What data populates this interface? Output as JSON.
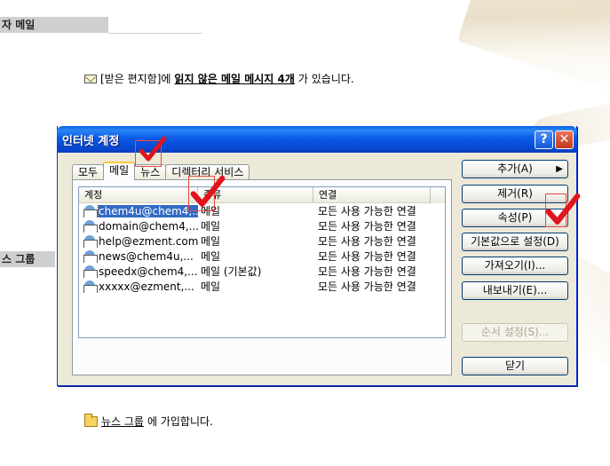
{
  "page": {
    "section1": "자 메일",
    "section2": "스 그룹",
    "msg_prefix": "[받은 편지함]에 ",
    "msg_strong": "읽지 않은 메일 메시지 4개",
    "msg_suffix": "가 있습니다.",
    "news_link": "뉴스 그룹",
    "news_suffix": "에 가입합니다."
  },
  "dialog": {
    "title": "인터넷 계정",
    "help_glyph": "?",
    "close_glyph": "✕",
    "tabs": [
      "모두",
      "메일",
      "뉴스",
      "디렉터리 서비스"
    ],
    "active_tab": "메일",
    "columns": [
      "계정",
      "종류",
      "연결"
    ],
    "accounts": [
      {
        "name": "chem4u@chem4,...",
        "type": "메일",
        "conn": "모든 사용 가능한 연결"
      },
      {
        "name": "domain@chem4,...",
        "type": "메일",
        "conn": "모든 사용 가능한 연결"
      },
      {
        "name": "help@ezment.com",
        "type": "메일",
        "conn": "모든 사용 가능한 연결"
      },
      {
        "name": "news@chem4u,...",
        "type": "메일",
        "conn": "모든 사용 가능한 연결"
      },
      {
        "name": "speedx@chem4,...",
        "type": "메일 (기본값)",
        "conn": "모든 사용 가능한 연결"
      },
      {
        "name": "xxxxx@ezment,...",
        "type": "메일",
        "conn": "모든 사용 가능한 연결"
      }
    ],
    "buttons": {
      "add": "추가(A)",
      "remove": "제거(R)",
      "properties": "속성(P)",
      "set_default": "기본값으로 설정(D)",
      "import": "가져오기(I)...",
      "export": "내보내기(E)...",
      "order": "순서 설정(S)...",
      "close": "닫기"
    },
    "add_arrow": "▶"
  },
  "colors": {
    "check_red": "#e0141e",
    "selection": "#316ac5"
  }
}
